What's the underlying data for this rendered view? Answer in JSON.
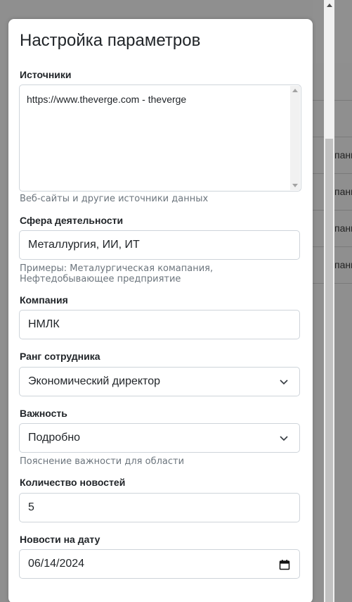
{
  "background": {
    "row_fragments": [
      "пани",
      "пани",
      "пани",
      "пани"
    ]
  },
  "modal": {
    "title": "Настройка параметров"
  },
  "sources": {
    "label": "Источники",
    "value": "https://www.theverge.com - theverge",
    "hint": "Веб-сайты и другие источники данных"
  },
  "sphere": {
    "label": "Сфера деятельности",
    "value": "Металлургия, ИИ, ИТ",
    "hint": "Примеры: Металургическая комапания, Нефтедобывающее предприятие"
  },
  "company": {
    "label": "Компания",
    "value": "НМЛК"
  },
  "rank": {
    "label": "Ранг сотрудника",
    "value": "Экономический директор"
  },
  "importance": {
    "label": "Важность",
    "value": "Подробно",
    "hint": "Пояснение важности для области"
  },
  "news_count": {
    "label": "Количество новостей",
    "value": "5"
  },
  "news_date": {
    "label": "Новости на дату",
    "value": "06/14/2024"
  },
  "colors": {
    "overlay": "#8f8f8f",
    "text": "#212529",
    "hint": "#6c757d",
    "border": "#ced4da"
  }
}
